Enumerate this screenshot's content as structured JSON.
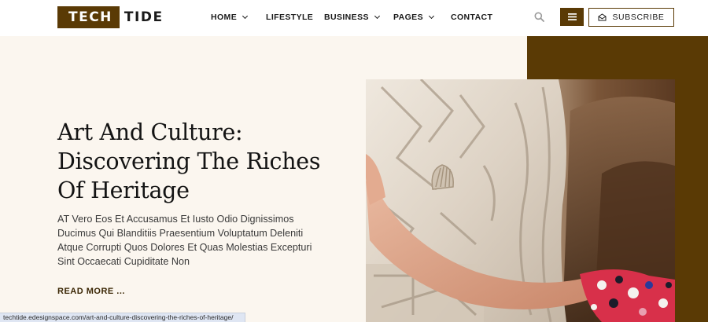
{
  "logo": {
    "box_text": "TECH",
    "rest_text": "TIDE"
  },
  "nav": {
    "items": [
      {
        "label": "HOME",
        "has_dropdown": true
      },
      {
        "label": "LIFESTYLE",
        "has_dropdown": false
      },
      {
        "label": "BUSINESS",
        "has_dropdown": true
      },
      {
        "label": "PAGES",
        "has_dropdown": true
      },
      {
        "label": "CONTACT",
        "has_dropdown": false
      }
    ]
  },
  "header_actions": {
    "search_icon": "search-icon",
    "menu_icon": "hamburger-icon",
    "subscribe_label": "SUBSCRIBE",
    "subscribe_icon": "envelope-icon"
  },
  "hero": {
    "title": "Art And Culture: Discovering The Riches Of Heritage",
    "excerpt": "AT Vero Eos Et Accusamus Et Iusto Odio Dignissimos Ducimus Qui Blanditiis Praesentium Voluptatum Deleniti Atque Corrupti Quos Dolores Et Quas Molestias Excepturi Sint Occaecati Cupiditate Non",
    "read_more": "READ MORE ..."
  },
  "status_bar": {
    "url": "techtide.edesignspace.com/art-and-culture-discovering-the-riches-of-heritage/"
  },
  "colors": {
    "brand_brown": "#5a3a05",
    "hero_background": "#fbf6ef"
  }
}
